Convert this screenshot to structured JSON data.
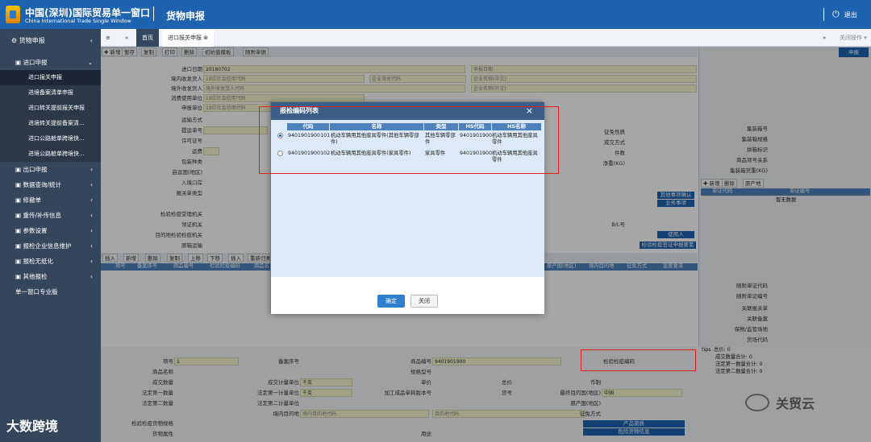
{
  "header": {
    "title_cn": "中国(深圳)国际贸易单一窗口",
    "title_en": "China International Trade Single Window",
    "section": "货物申报",
    "exit_label": "退出"
  },
  "sidebar": {
    "top": "货物申报",
    "group": "进口申报",
    "sub_items": [
      "进口报关申报",
      "进境备案清单申报",
      "进口转关提前报关申报",
      "进境转关提前备案清...",
      "进口公路舱单跨境快...",
      "进境公路舱单跨境快..."
    ],
    "items": [
      "出口申报",
      "数据查询/统计",
      "修撤单",
      "重传/补传信息",
      "参数设置",
      "报检企业信息维护",
      "报检无纸化",
      "其他报检",
      "单一窗口专业版"
    ]
  },
  "tabs": {
    "menu_icon": "≡",
    "back_icon": "«",
    "home": "首页",
    "active": "进口报关申报 ⊗",
    "right_icon": "»",
    "close_ops": "关闭操作 ▾"
  },
  "toolbar": [
    "✚ 新增",
    "暂存",
    "复制",
    "打印",
    "删除",
    "初始值模板",
    "随附单据"
  ],
  "toolbar_right": "申报",
  "form_labels": [
    "进口日期",
    "境内收发货人",
    "境外收发货人",
    "消费使用单位",
    "申报单位",
    "运输方式",
    "提运单号",
    "许可证号",
    "运费",
    "包装种类",
    "启运国(地区)",
    "入境口岸",
    "报关单类型",
    "检验检疫受理机关",
    "领证机关",
    "目的地检验检疫机关",
    "原箱运输"
  ],
  "form_values": {
    "import_date": "20180702",
    "sc_code": "18位社会信用代码",
    "overseas": "境外收发货人代码",
    "consumer": "18位社会信用代码",
    "declarant": "18位社会信用代码",
    "ent_code": "企业海关代码",
    "name_cn": "企业名称(中文)",
    "name_en": "企业名称(外文)",
    "declare_date": "申报日期"
  },
  "right_labels": [
    "征免性质",
    "成交方式",
    "件数",
    "净重(KG)",
    "B/L号"
  ],
  "right_panel_labels": [
    "集装箱号",
    "集装箱规格",
    "拼箱标识",
    "商品项号关系",
    "集装箱货重(KG)",
    "随附单证代码",
    "随附单证编号",
    "关联报关单",
    "关联备案",
    "保税/监管场地",
    "货场代码"
  ],
  "right_grid": {
    "col1": "单证代码",
    "col2": "单证编号",
    "empty": "暂无数据",
    "btns": [
      "✚ 新增",
      "删除",
      "原产地"
    ]
  },
  "right_small_btns": [
    "其他事项确认",
    "业务事项",
    "使用人",
    "检验检疫签证申报要素"
  ],
  "grid_cols": [
    "项号",
    "备案序号",
    "商品编号",
    "检验检疫编码",
    "商品名"
  ],
  "grid_cols_right": [
    "原产国(地区)",
    "境内目的地",
    "征免方式",
    "监管要求"
  ],
  "grid_tools": [
    "插入",
    "新增",
    "删除",
    "复制",
    "上移",
    "下移",
    "插入",
    "重新归类"
  ],
  "bottom_labels": [
    "项号",
    "商品名称",
    "成交数量",
    "法定第一数量",
    "法定第二数量",
    "检验检疫货物规格",
    "货物属性",
    "备案序号",
    "成交计量单位",
    "法定第一计量单位",
    "法定第二计量单位",
    "境内目的地",
    "商品编号",
    "规格型号",
    "单价",
    "总价",
    "币制",
    "加工成品单耗版本号",
    "货号",
    "原产国(地区)",
    "最终目的国(地区)",
    "征免方式",
    "用途"
  ],
  "bottom_values": {
    "item_no": "1",
    "hs": "9401901900",
    "unit1": "千克",
    "unit2": "千克",
    "dest": "境内目的地代码",
    "dest2": "目的地代码",
    "origin": "中国"
  },
  "bottom_btns": [
    "产品资质",
    "危险货物信息"
  ],
  "tips": {
    "title": "tips",
    "lines": [
      "总价: 0",
      "成交数量合计: 0",
      "法定第一数量合计: 0",
      "法定第二数量合计: 0"
    ]
  },
  "ciq_code_label": "检验检疫编码",
  "dialog": {
    "title": "报检编码列表",
    "close": "×",
    "headers": [
      "代码",
      "名称",
      "类型",
      "HS代码",
      "HS名称"
    ],
    "rows": [
      {
        "selected": true,
        "code": "9401901900101",
        "name": "机动车辆用其他座具零件(其他车辆零部件)",
        "type": "其他车辆零部件",
        "hs": "9401901900",
        "hs_name": "机动车辆用其他座具零件"
      },
      {
        "selected": false,
        "code": "9401901900102",
        "name": "机动车辆用其他座具零件(家具零件)",
        "type": "家具零件",
        "hs": "9401901900",
        "hs_name": "机动车辆用其他座具零件"
      }
    ],
    "ok": "确定",
    "cancel": "关闭"
  },
  "watermark_left": "大数跨境",
  "watermark_right": "关贸云",
  "colors": {
    "header": "#1e63b0",
    "sidebar": "#34465c",
    "grid_header": "#4f81bd",
    "highlight": "#e02020"
  }
}
